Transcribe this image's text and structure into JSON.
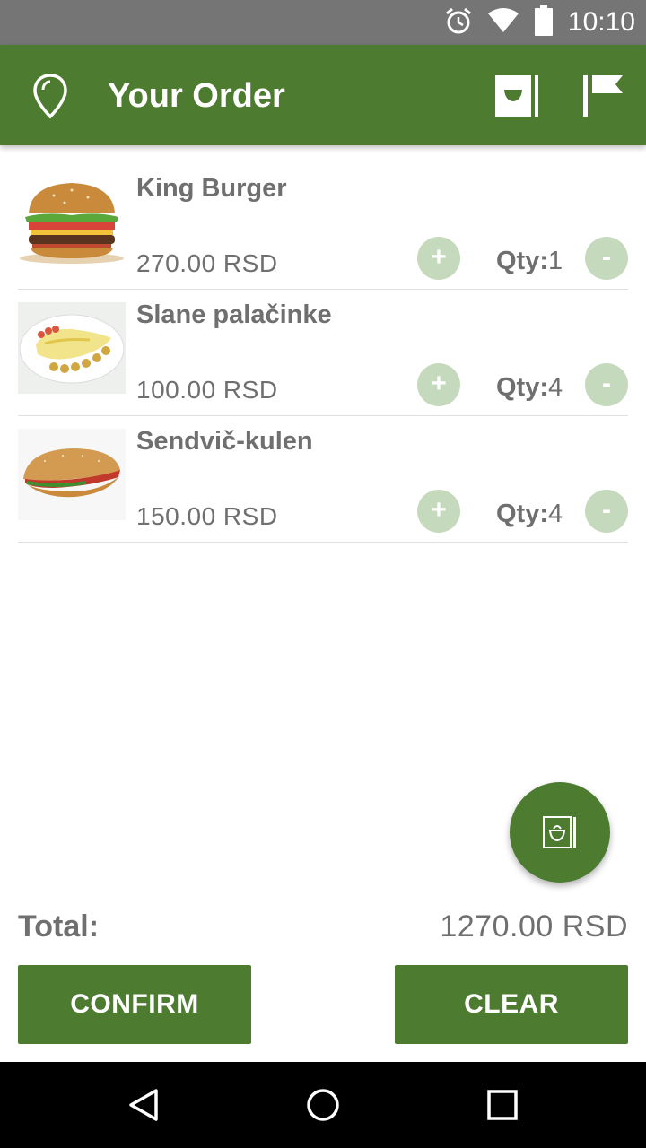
{
  "status_bar": {
    "time": "10:10",
    "icons": [
      "alarm-icon",
      "wifi-icon",
      "battery-icon"
    ]
  },
  "app_bar": {
    "title": "Your Order",
    "icons": [
      "location-pin-icon",
      "order-bag-icon",
      "flag-icon"
    ],
    "color": "#4d7c31"
  },
  "order": {
    "items": [
      {
        "name": "King Burger",
        "price": "270.00 RSD",
        "qty_label": "Qty:",
        "qty": "1",
        "plus": "+",
        "minus": "-",
        "image": "burger-image"
      },
      {
        "name": "Slane palačinke",
        "price": "100.00 RSD",
        "qty_label": "Qty:",
        "qty": "4",
        "plus": "+",
        "minus": "-",
        "image": "pancakes-image"
      },
      {
        "name": "Sendvič-kulen",
        "price": "150.00 RSD",
        "qty_label": "Qty:",
        "qty": "4",
        "plus": "+",
        "minus": "-",
        "image": "sandwich-image"
      }
    ]
  },
  "fab": {
    "icon": "order-menu-icon"
  },
  "total": {
    "label": "Total:",
    "value": "1270.00 RSD"
  },
  "actions": {
    "confirm_label": "CONFIRM",
    "clear_label": "CLEAR"
  },
  "nav_bar": {
    "icons": [
      "back-icon",
      "home-icon",
      "recents-icon"
    ]
  },
  "colors": {
    "primary": "#4d7c31",
    "button_light": "#c5d9bd",
    "text_gray": "#6f6f6f"
  }
}
